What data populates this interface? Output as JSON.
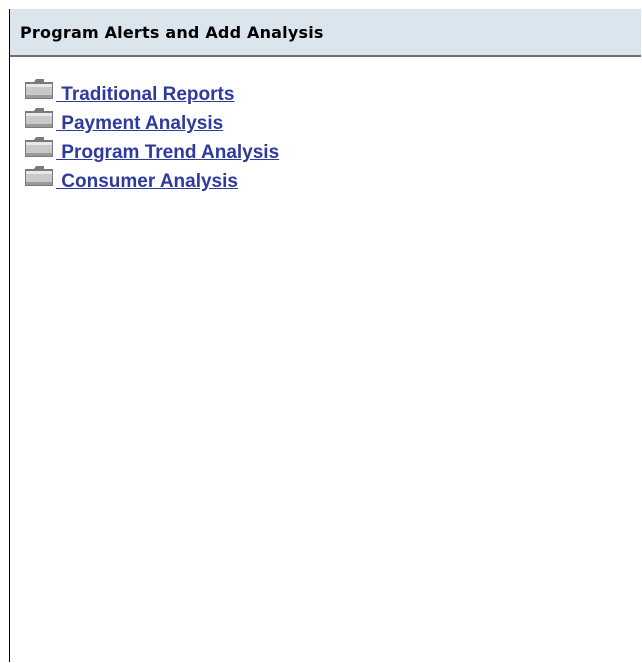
{
  "panel": {
    "title": "Program Alerts and Add Analysis"
  },
  "colors": {
    "header_background": "#dbe5ee",
    "link": "#2e3a9e"
  },
  "folders": [
    {
      "label": " Traditional Reports",
      "icon": "folder-icon"
    },
    {
      "label": " Payment Analysis",
      "icon": "folder-icon"
    },
    {
      "label": " Program Trend Analysis",
      "icon": "folder-icon"
    },
    {
      "label": " Consumer Analysis",
      "icon": "folder-icon"
    }
  ]
}
